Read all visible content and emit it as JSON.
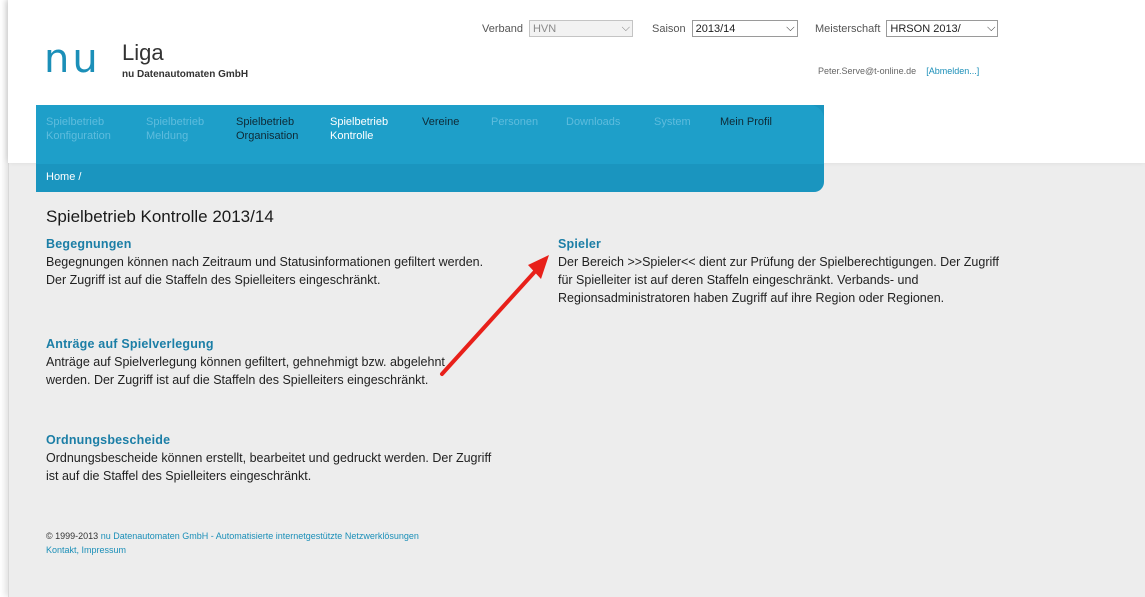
{
  "logo": {
    "mark": "nu",
    "name": "Liga",
    "company": "nu Datenautomaten GmbH"
  },
  "selectors": {
    "verband": {
      "label": "Verband",
      "value": "HVN"
    },
    "saison": {
      "label": "Saison",
      "value": "2013/14"
    },
    "meisterschaft": {
      "label": "Meisterschaft",
      "value": "HRSON 2013/"
    }
  },
  "user": {
    "email": "Peter.Serve@t-online.de",
    "logout": "[Abmelden...]"
  },
  "nav": {
    "items": [
      {
        "line1": "Spielbetrieb",
        "line2": "Konfiguration"
      },
      {
        "line1": "Spielbetrieb",
        "line2": "Meldung"
      },
      {
        "line1": "Spielbetrieb",
        "line2": "Organisation"
      },
      {
        "line1": "Spielbetrieb",
        "line2": "Kontrolle"
      },
      {
        "line1": "Vereine",
        "line2": ""
      },
      {
        "line1": "Personen",
        "line2": ""
      },
      {
        "line1": "Downloads",
        "line2": ""
      },
      {
        "line1": "System",
        "line2": ""
      },
      {
        "line1": "Mein Profil",
        "line2": ""
      }
    ]
  },
  "breadcrumb": "Home /",
  "page_title": "Spielbetrieb Kontrolle 2013/14",
  "sections": {
    "begegnungen": {
      "title": "Begegnungen",
      "text": "Begegnungen können nach Zeitraum und Statusinformationen gefiltert werden. Der Zugriff ist auf die Staffeln des Spielleiters eingeschränkt."
    },
    "antraege": {
      "title": "Anträge auf Spielverlegung",
      "text": "Anträge auf Spielverlegung können gefiltert, gehnehmigt bzw. abgelehnt werden. Der Zugriff ist auf die Staffeln des Spielleiters eingeschränkt."
    },
    "ordnung": {
      "title": "Ordnungsbescheide",
      "text": "Ordnungsbescheide können erstellt, bearbeitet und gedruckt werden. Der Zugriff ist auf die Staffel des Spielleiters eingeschränkt."
    },
    "spieler": {
      "title": "Spieler",
      "text": "Der Bereich >>Spieler<< dient zur Prüfung der Spielberechtigungen. Der Zugriff für Spielleiter ist auf deren Staffeln eingeschränkt. Verbands- und Regionsadministratoren haben Zugriff auf ihre Region oder Regionen."
    }
  },
  "footer": {
    "copyright": "© 1999-2013",
    "company_link": "nu Datenautomaten GmbH - Automatisierte internetgestützte Netzwerklösungen",
    "contact": "Kontakt",
    "impressum": "Impressum"
  },
  "colors": {
    "brand": "#1b8fb8",
    "nav": "#1e9fc9",
    "annotation_arrow": "#e8201a"
  }
}
